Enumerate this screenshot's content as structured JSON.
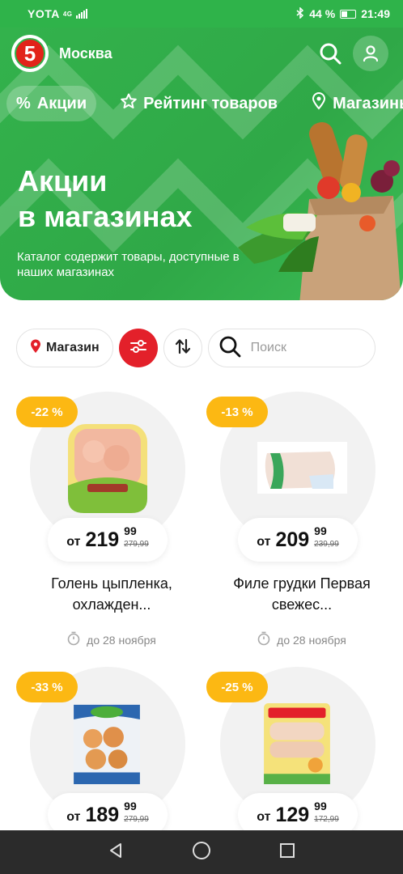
{
  "status_bar": {
    "carrier": "YOTA",
    "network": "4G",
    "battery": "44 %",
    "time": "21:49"
  },
  "header": {
    "logo_text": "5",
    "city": "Москва"
  },
  "chips": [
    {
      "icon": "%",
      "label": "Акции"
    },
    {
      "icon": "star",
      "label": "Рейтинг товаров"
    },
    {
      "icon": "pin",
      "label": "Магазины"
    }
  ],
  "hero": {
    "title_line1": "Акции",
    "title_line2": "в магазинах",
    "subtitle": "Каталог содержит товары, доступные в наших магазинах"
  },
  "filters": {
    "store_label": "Магазин",
    "search_placeholder": "Поиск"
  },
  "products": [
    {
      "discount": "-22 %",
      "from": "от",
      "price": "219",
      "kop": "99",
      "old": "279,99",
      "name": "Голень цыпленка, охлажден...",
      "until": "до 28 ноября"
    },
    {
      "discount": "-13 %",
      "from": "от",
      "price": "209",
      "kop": "99",
      "old": "239,99",
      "name": "Филе грудки Первая свежес...",
      "until": "до 28 ноября"
    },
    {
      "discount": "-33 %",
      "from": "от",
      "price": "189",
      "kop": "99",
      "old": "279,99",
      "name": "",
      "until": ""
    },
    {
      "discount": "-25 %",
      "from": "от",
      "price": "129",
      "kop": "99",
      "old": "172,99",
      "name": "",
      "until": ""
    }
  ],
  "colors": {
    "brand_green": "#2fb34a",
    "brand_red": "#e3202a",
    "discount_yellow": "#fcb813"
  }
}
